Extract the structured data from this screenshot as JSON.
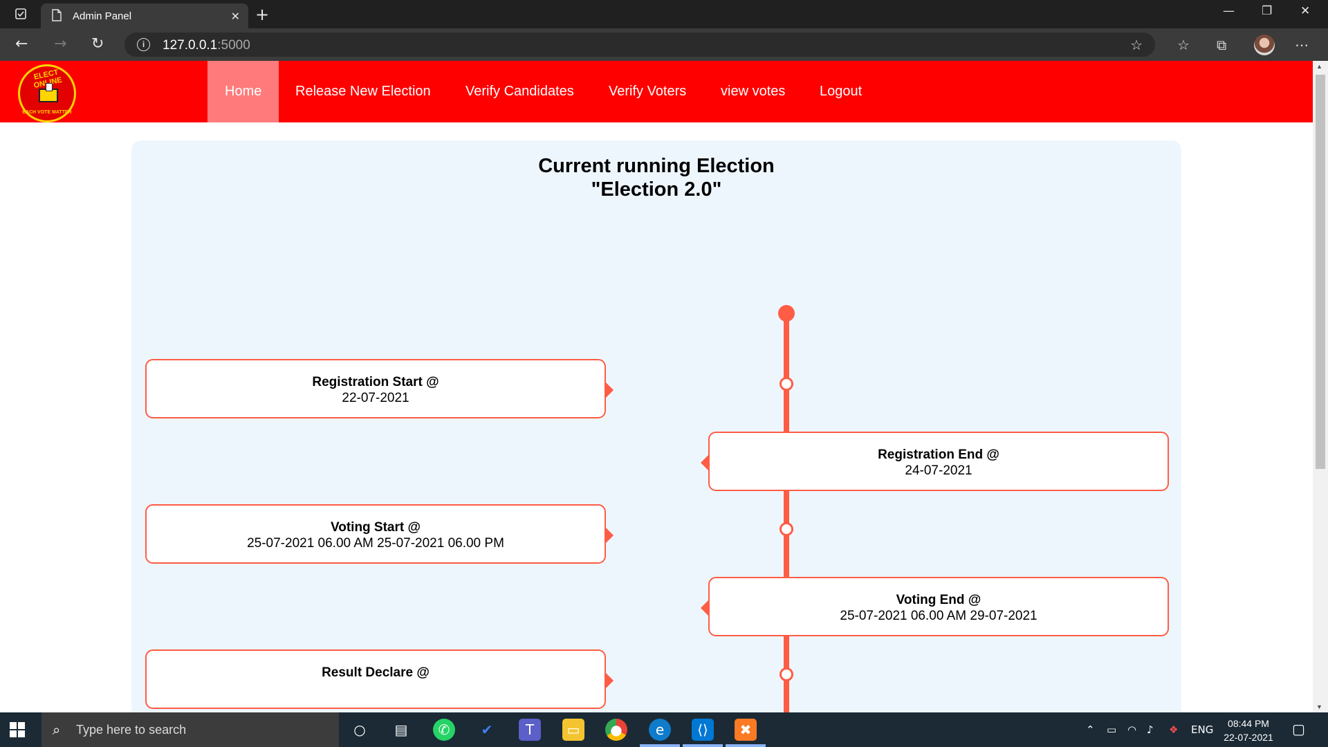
{
  "browser": {
    "tab_title": "Admin Panel",
    "url_host": "127.0.0.1",
    "url_port": ":5000"
  },
  "navbar": {
    "logo_top_text": "ELECT ONLINE",
    "logo_bottom_text": "EACH VOTE MATTER",
    "items": [
      {
        "label": "Home",
        "active": true
      },
      {
        "label": "Release New Election"
      },
      {
        "label": "Verify Candidates"
      },
      {
        "label": "Verify Voters"
      },
      {
        "label": "view votes"
      },
      {
        "label": "Logout"
      }
    ]
  },
  "main": {
    "title_line1": "Current running Election",
    "title_line2": "\"Election 2.0\"",
    "timeline": [
      {
        "label": "Registration Start @",
        "value": "22-07-2021",
        "side": "left"
      },
      {
        "label": "Registration End @",
        "value": "24-07-2021",
        "side": "right"
      },
      {
        "label": "Voting Start @",
        "value": "25-07-2021 06.00 AM 25-07-2021 06.00 PM",
        "side": "left"
      },
      {
        "label": "Voting End @",
        "value": "25-07-2021 06.00 AM 29-07-2021",
        "side": "right"
      },
      {
        "label": "Result Declare @",
        "value": "",
        "side": "left"
      }
    ],
    "accent_color": "#ff5c45",
    "nav_color": "#ff0000"
  },
  "taskbar": {
    "search_placeholder": "Type here to search",
    "language": "ENG",
    "time": "08:44 PM",
    "date": "22-07-2021"
  }
}
